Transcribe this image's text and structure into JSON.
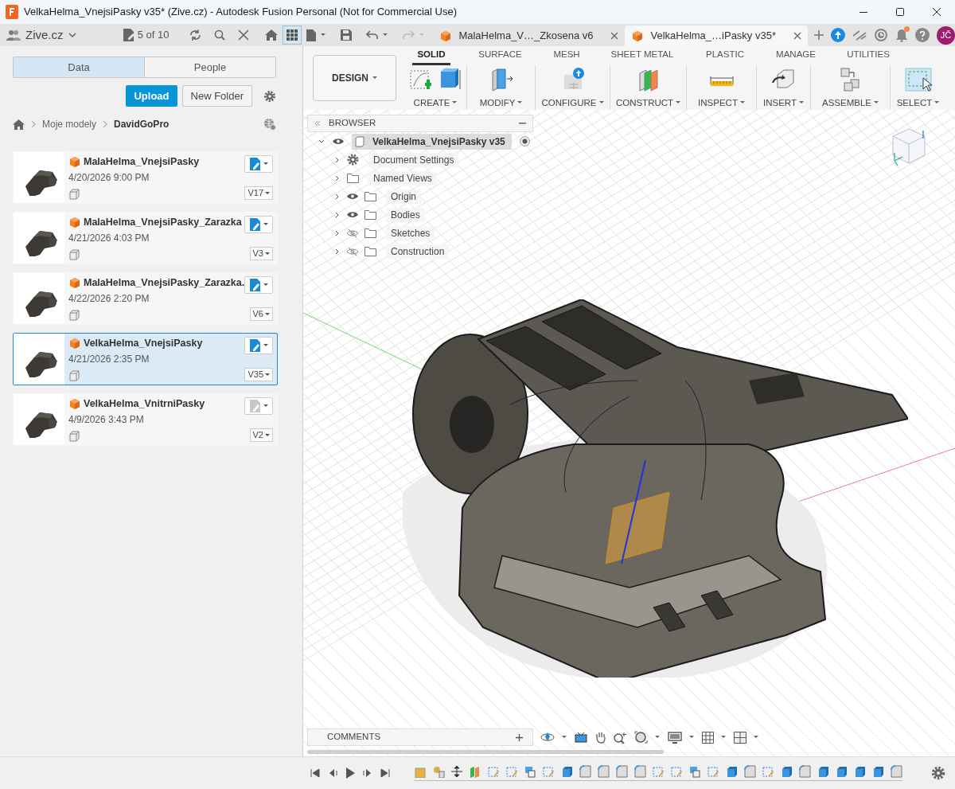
{
  "window": {
    "title": "VelkaHelma_VnejsiPasky v35* (Zive.cz) - Autodesk Fusion Personal (Not for Commercial Use)"
  },
  "top_bar": {
    "team": "Zive.cz",
    "file_count": "5 of 10"
  },
  "document_tabs": [
    {
      "label": "MalaHelma_V…_Zkosena v6",
      "selected": false
    },
    {
      "label": "VelkaHelma_…iPasky v35*",
      "selected": true
    }
  ],
  "user": {
    "initials": "JČ"
  },
  "data_panel": {
    "tabs": [
      {
        "label": "Data",
        "selected": true
      },
      {
        "label": "People",
        "selected": false
      }
    ],
    "upload_button": "Upload",
    "new_folder_button": "New Folder",
    "breadcrumb": [
      "Moje modely",
      "DavidGoPro"
    ],
    "files": [
      {
        "name": "MalaHelma_VnejsiPasky",
        "date": "4/20/2026 9:00 PM",
        "version": "V17",
        "selected": false,
        "editable": true
      },
      {
        "name": "MalaHelma_VnejsiPasky_Zarazka",
        "date": "4/21/2026 4:03 PM",
        "version": "V3",
        "selected": false,
        "editable": true
      },
      {
        "name": "MalaHelma_VnejsiPasky_Zarazka.",
        "date": "4/22/2026 2:20 PM",
        "version": "V6",
        "selected": false,
        "editable": true
      },
      {
        "name": "VelkaHelma_VnejsiPasky",
        "date": "4/21/2026 2:35 PM",
        "version": "V35",
        "selected": true,
        "editable": true
      },
      {
        "name": "VelkaHelma_VnitrniPasky",
        "date": "4/9/2026 3:43 PM",
        "version": "V2",
        "selected": false,
        "editable": false
      }
    ]
  },
  "workspace": {
    "label": "DESIGN"
  },
  "toolbar": {
    "tabs": [
      {
        "label": "SOLID",
        "selected": true
      },
      {
        "label": "SURFACE",
        "selected": false
      },
      {
        "label": "MESH",
        "selected": false
      },
      {
        "label": "SHEET METAL",
        "selected": false
      },
      {
        "label": "PLASTIC",
        "selected": false
      },
      {
        "label": "MANAGE",
        "selected": false
      },
      {
        "label": "UTILITIES",
        "selected": false
      }
    ],
    "groups": [
      {
        "label": "CREATE",
        "kind": "create"
      },
      {
        "label": "MODIFY",
        "kind": "modify"
      },
      {
        "label": "CONFIGURE",
        "kind": "configure"
      },
      {
        "label": "CONSTRUCT",
        "kind": "construct"
      },
      {
        "label": "INSPECT",
        "kind": "inspect"
      },
      {
        "label": "INSERT",
        "kind": "insert"
      },
      {
        "label": "ASSEMBLE",
        "kind": "assemble"
      },
      {
        "label": "SELECT",
        "kind": "select"
      }
    ]
  },
  "browser": {
    "title": "BROWSER",
    "root": {
      "label": "VelkaHelma_VnejsiPasky v35",
      "expanded": true,
      "visible": true,
      "selected": true,
      "children": [
        {
          "label": "Document Settings",
          "kind": "settings",
          "expanded": false,
          "selected": false
        },
        {
          "label": "Named Views",
          "kind": "folder",
          "expanded": false,
          "selected": false
        },
        {
          "label": "Origin",
          "kind": "folder",
          "visible": true,
          "expanded": false,
          "selected": false
        },
        {
          "label": "Bodies",
          "kind": "folder",
          "visible": true,
          "expanded": false,
          "selected": false
        },
        {
          "label": "Sketches",
          "kind": "folder",
          "visible": false,
          "expanded": false,
          "selected": false
        },
        {
          "label": "Construction",
          "kind": "folder",
          "visible": false,
          "expanded": false,
          "selected": false
        }
      ]
    }
  },
  "comments": {
    "title": "COMMENTS"
  }
}
